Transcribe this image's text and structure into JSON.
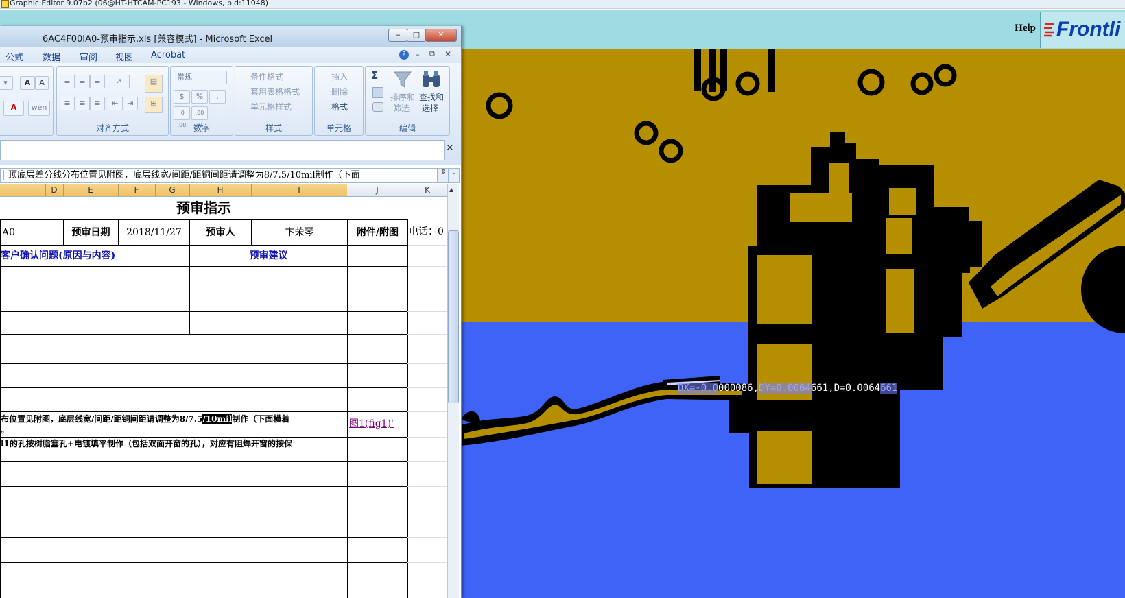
{
  "graphic_editor": {
    "title": "Graphic Editor 9.07b2 (06@HT-HTCAM-PC193 - Windows, pid:11048)",
    "help": "Help",
    "brand": "Frontli",
    "readout": {
      "dx_prefix": "DX=-0.0",
      "dx_rest": "000086,",
      "dy_prefix": "DY=0.00",
      "dy_hl": "64",
      "dy_rest": "661,D=0.0064",
      "d_hl": "661"
    },
    "colors": {
      "copper": "#b58f00",
      "substrate": "#3f63f7",
      "trace": "#000000"
    }
  },
  "excel": {
    "title": "6AC4F00IA0-预审指示.xls  [兼容模式] - Microsoft Excel",
    "window_buttons": {
      "minimize": "‒",
      "maximize": "□",
      "close": "✕"
    },
    "tabs": [
      "公式",
      "数据",
      "审阅",
      "视图",
      "Acrobat"
    ],
    "ribbon": {
      "alignment_label": "对齐方式",
      "number_label": "数字",
      "number_format": "常规",
      "styles_label": "样式",
      "cells_label": "单元格",
      "editing_label": "编辑",
      "conditional_format": "条件格式",
      "table_format": "套用表格格式",
      "cell_styles": "单元格样式",
      "insert": "插入",
      "delete": "删除",
      "format": "格式",
      "sort_filter_1": "排序和",
      "sort_filter_2": "筛选",
      "find_select_1": "查找和",
      "find_select_2": "选择",
      "percent": "%",
      "comma": ",",
      "dec_inc": ".0 .00",
      "dec_dec": ".00 .0",
      "sum": "Σ"
    },
    "formula_bar": "顶底层差分线分布位置见附图，底层线宽/间距/距铜间距请调整为8/7.5/10mil制作（下面",
    "columns": [
      "D",
      "E",
      "F",
      "G",
      "H",
      "I",
      "J",
      "K"
    ],
    "sheet": {
      "heading": "预审指示",
      "row1": {
        "a": "A0",
        "date_label": "预审日期",
        "date": "2018/11/27",
        "reviewer_label": "预审人",
        "reviewer": "卞荣琴",
        "attach_label": "附件/附图",
        "phone": "电话：0"
      },
      "row2": {
        "question": "客户确认问题(原因与内容)",
        "suggestion": "预审建议"
      },
      "note1_pre": "布位置见附图，底层线宽/间距/距铜间距请调整为8/7.5",
      "note1_sel": "/10mil",
      "note1_post": "制作（下面横着",
      "note1_line2": "。",
      "note1_link": "图1(fig1)'",
      "note2": "l1的孔按树脂塞孔+电镀填平制作（包括双面开窗的孔），对应有阻焊开窗的按保"
    }
  }
}
